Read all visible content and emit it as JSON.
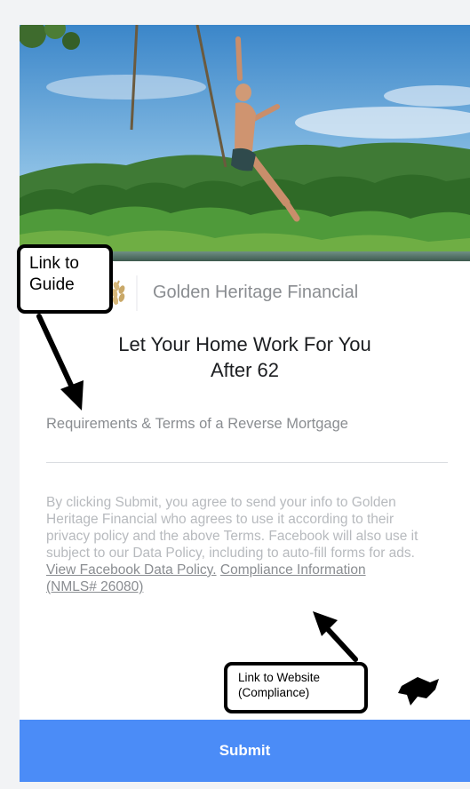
{
  "ad": {
    "hero_image": "hero-photo-man-swinging-from-rope-over-river",
    "brand": {
      "logo_icon": "wheat-laurel-logo-icon",
      "name": "Golden Heritage Financial"
    },
    "headline": {
      "line1": "Let Your Home Work For You",
      "line2": "After 62"
    },
    "guide_link": "Requirements & Terms of a Reverse Mortgage",
    "disclaimer": {
      "text": "By clicking Submit, you agree to send your info to Golden Heritage Financial who agrees to use it according to their privacy policy and the above Terms. Facebook will also use it subject to our Data Policy, including to auto-fill forms for ads.",
      "data_policy_link": "View Facebook Data Policy.",
      "compliance_link": "Compliance Information (NMLS# 26080)"
    },
    "submit_label": "Submit"
  },
  "annotations": {
    "guide_callout": {
      "line1": "Link to",
      "line2": "Guide"
    },
    "website_callout": {
      "line1": "Link to Website",
      "line2": "(Compliance)"
    }
  },
  "colors": {
    "submit_bg": "#4b8cf7",
    "page_bg": "#f2f3f5",
    "muted_text": "#8a8d91",
    "disclaimer_text": "#b7babe"
  }
}
